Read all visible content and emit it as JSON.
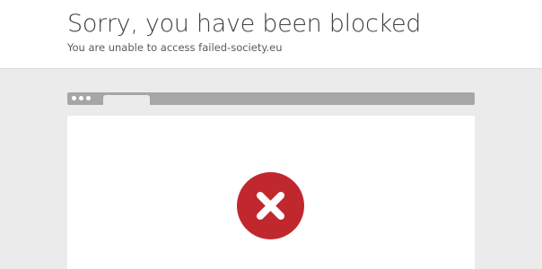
{
  "page": {
    "title": "Sorry, you have been blocked",
    "subtitle": "You are unable to access failed-society.eu"
  },
  "illustration": {
    "icon": "blocked-x-icon",
    "icon_color": "#c0282e",
    "browser_bar_color": "#a6a6a6",
    "background_color": "#ebebeb"
  }
}
